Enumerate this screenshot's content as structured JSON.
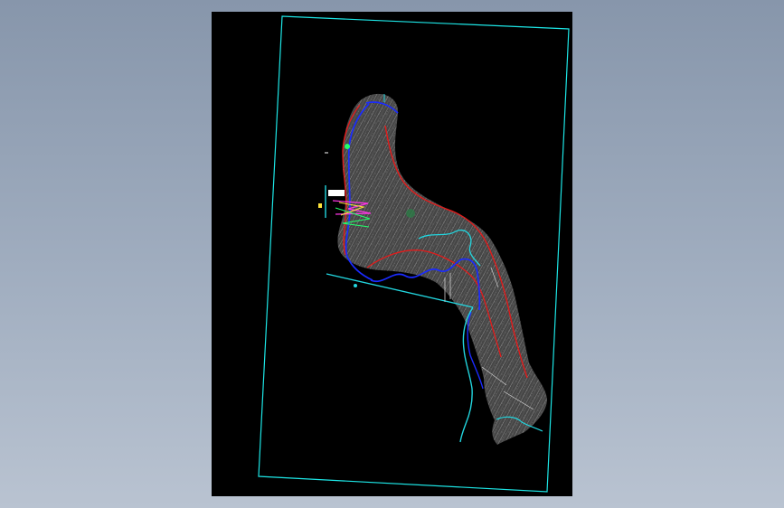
{
  "viewer": {
    "background_top": "#8796ab",
    "background_bottom": "#b9c3d1",
    "canvas_color": "#000000"
  },
  "drawing": {
    "frame_color": "#1de6e6",
    "terrain_color": "#8b8b8b",
    "boundary_color": "#e31b1b",
    "road_color": "#1a2bff",
    "water_color": "#22d6df",
    "accent_colors": [
      "#ff36e5",
      "#22ff6a",
      "#ffe43a",
      "#ffffff"
    ]
  }
}
